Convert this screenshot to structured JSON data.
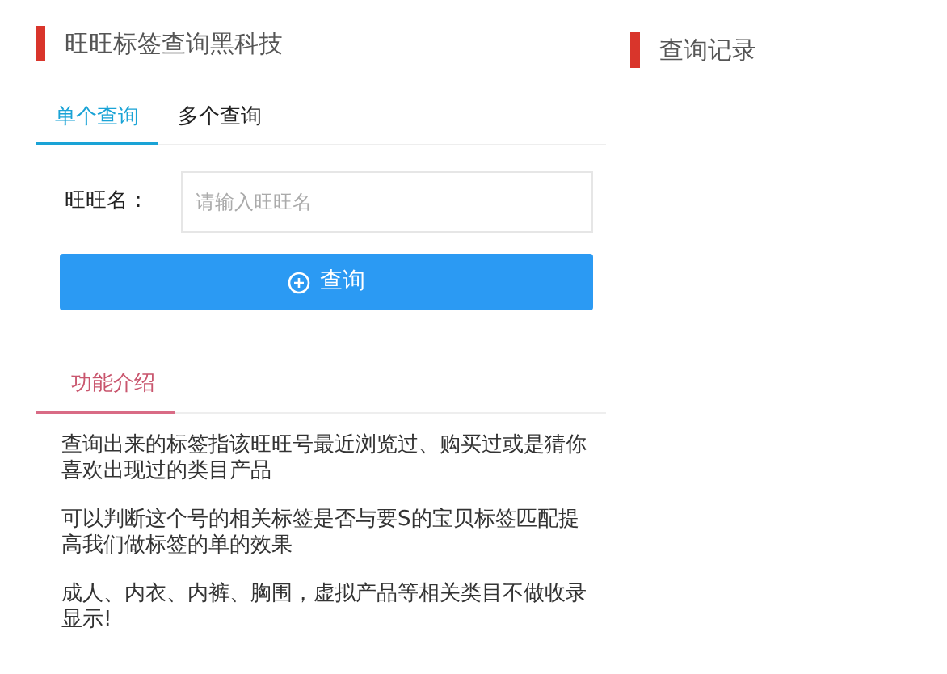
{
  "main_panel": {
    "title": "旺旺标签查询黑科技",
    "tabs": [
      {
        "label": "单个查询",
        "selected": true
      },
      {
        "label": "多个查询",
        "selected": false
      }
    ],
    "form": {
      "label": "旺旺名：",
      "placeholder": "请输入旺旺名",
      "button": "查询"
    },
    "intro": {
      "title": "功能介绍",
      "paragraphs": [
        "查询出来的标签指该旺旺号最近浏览过、购买过或是猜你喜欢出现过的类目产品",
        "可以判断这个号的相关标签是否与要S的宝贝标签匹配提高我们做标签的单的效果",
        "成人、内衣、内裤、胸围，虚拟产品等相关类目不做收录显示!"
      ]
    }
  },
  "side_panel": {
    "title": "查询记录"
  }
}
